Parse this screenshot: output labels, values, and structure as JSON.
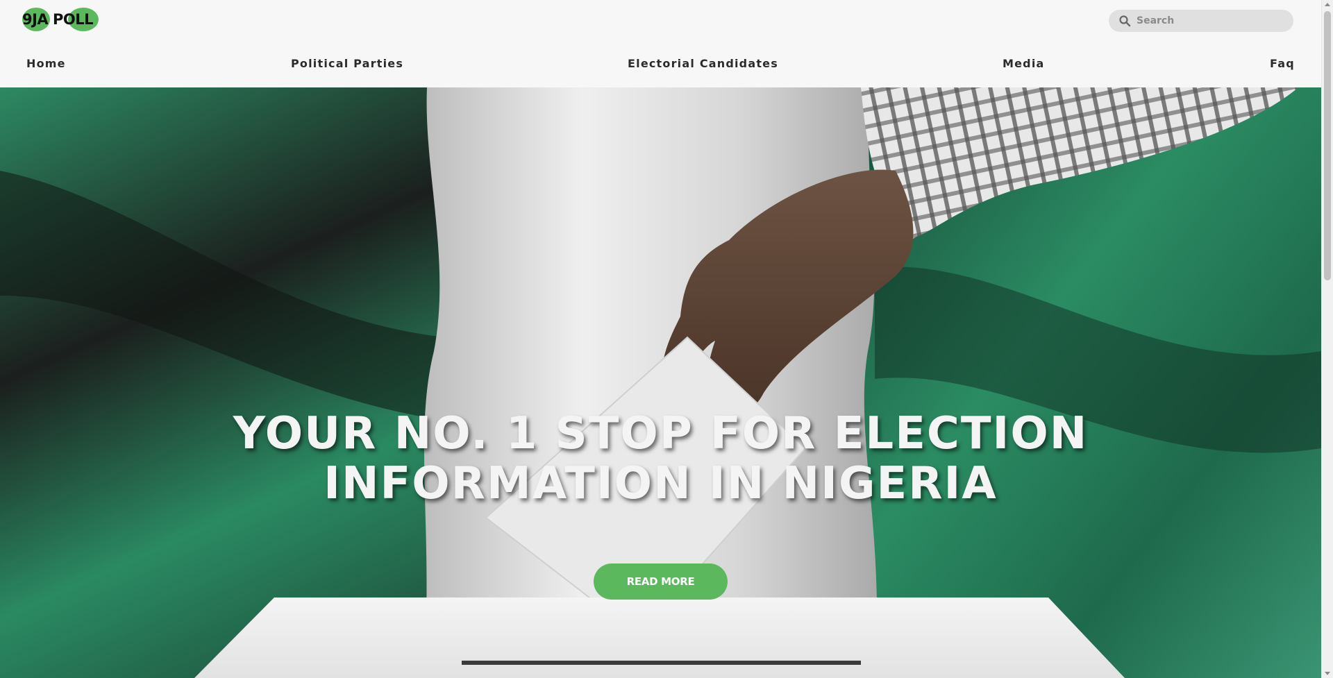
{
  "brand": {
    "logo_text": "9JA POLL"
  },
  "search": {
    "placeholder": "Search",
    "value": ""
  },
  "nav": {
    "items": [
      {
        "label": "Home"
      },
      {
        "label": "Political Parties"
      },
      {
        "label": "Electorial Candidates"
      },
      {
        "label": "Media"
      },
      {
        "label": "Faq"
      }
    ]
  },
  "hero": {
    "title_line1": "YOUR NO. 1 STOP FOR ELECTION",
    "title_line2": "INFORMATION IN NIGERIA",
    "cta_label": "READ MORE"
  },
  "colors": {
    "accent": "#5cb85c",
    "flag_green": "#1f7a55",
    "flag_white": "#eeeeee",
    "header_bg": "#f7f7f7"
  },
  "icons": [
    "search-icon",
    "chevron-up-icon",
    "chevron-down-icon"
  ]
}
